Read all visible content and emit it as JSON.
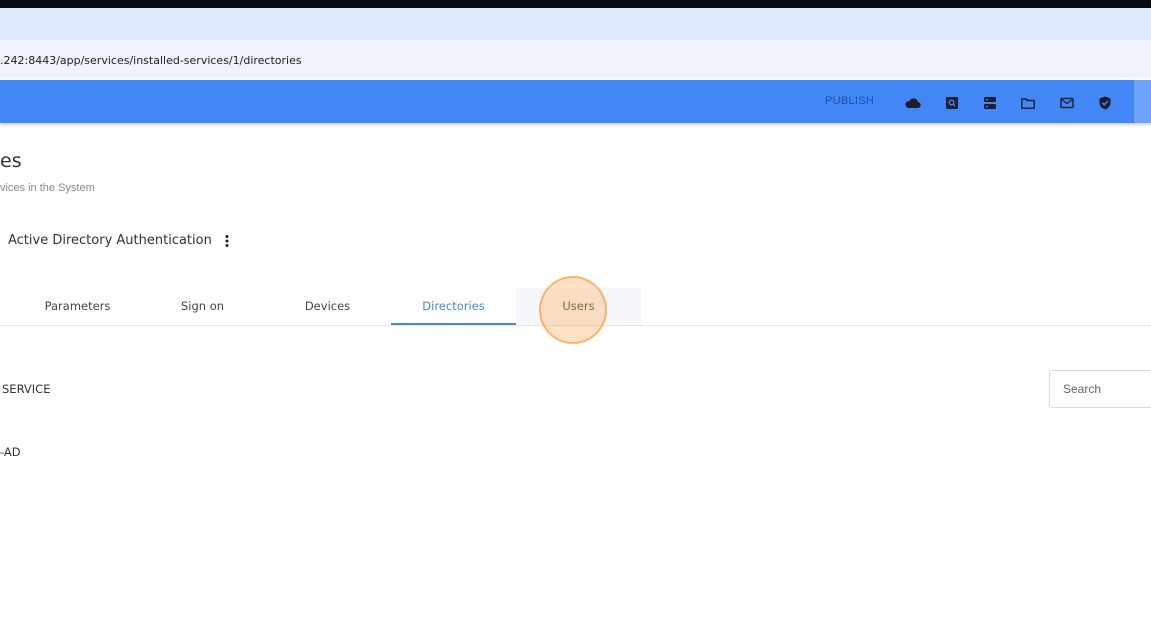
{
  "browser": {
    "address": ".242:8443/app/services/installed-services/1/directories"
  },
  "toolbar": {
    "publish_label": "PUBLISH",
    "icons": [
      "cloud-icon",
      "search-square-icon",
      "server-icon",
      "folder-icon",
      "mail-icon",
      "shield-check-icon"
    ]
  },
  "page": {
    "title": "es",
    "subtitle": "vices in the System"
  },
  "service": {
    "name": "Active Directory Authentication"
  },
  "tabs": [
    {
      "label": "Parameters"
    },
    {
      "label": "Sign on"
    },
    {
      "label": "Devices"
    },
    {
      "label": "Directories"
    },
    {
      "label": "Users"
    }
  ],
  "active_tab": "Directories",
  "table": {
    "header_label": "SERVICE",
    "rows": [
      {
        "name": "-AD"
      }
    ]
  },
  "search": {
    "placeholder": "Search",
    "value": ""
  },
  "colors": {
    "appbar": "#4287f5",
    "active_tab": "#4a86c8",
    "click_marker": "#ffab5a"
  }
}
